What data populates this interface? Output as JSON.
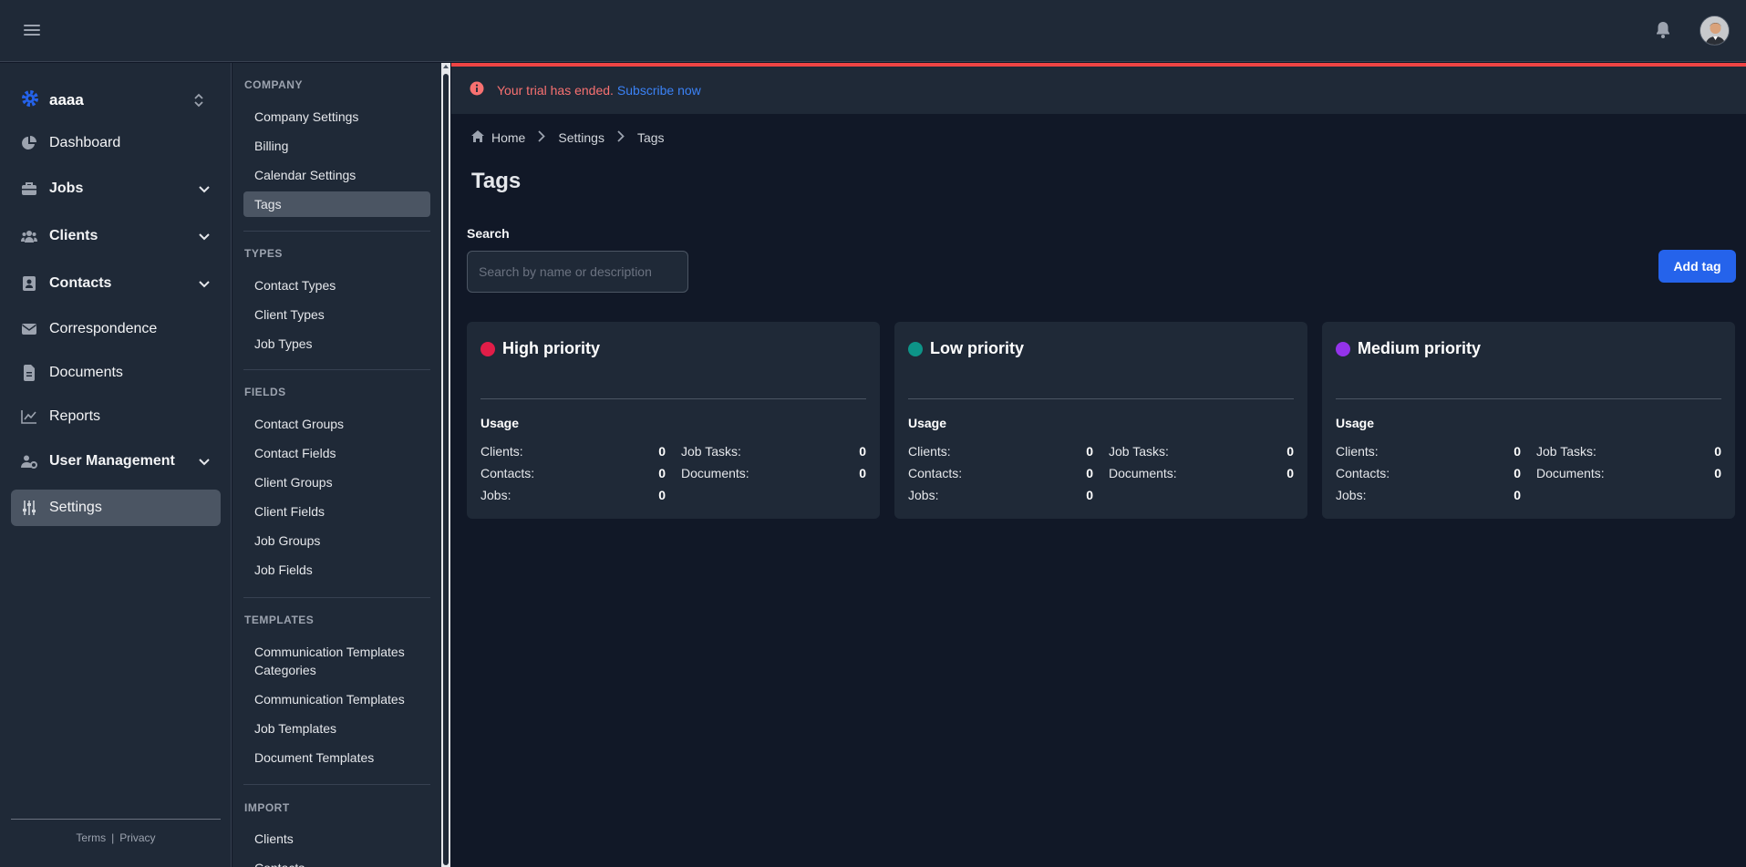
{
  "company": {
    "name": "aaaa"
  },
  "nav": {
    "dashboard": "Dashboard",
    "jobs": "Jobs",
    "clients": "Clients",
    "contacts": "Contacts",
    "correspondence": "Correspondence",
    "documents": "Documents",
    "reports": "Reports",
    "user_management": "User Management",
    "settings": "Settings"
  },
  "footer": {
    "terms": "Terms",
    "sep": "|",
    "privacy": "Privacy"
  },
  "subnav": {
    "company_header": "COMPANY",
    "company_settings": "Company Settings",
    "billing": "Billing",
    "calendar_settings": "Calendar Settings",
    "tags": "Tags",
    "types_header": "TYPES",
    "contact_types": "Contact Types",
    "client_types": "Client Types",
    "job_types": "Job Types",
    "fields_header": "FIELDS",
    "contact_groups": "Contact Groups",
    "contact_fields": "Contact Fields",
    "client_groups": "Client Groups",
    "client_fields": "Client Fields",
    "job_groups": "Job Groups",
    "job_fields": "Job Fields",
    "templates_header": "TEMPLATES",
    "comm_templates_categories": "Communication Templates Categories",
    "comm_templates": "Communication Templates",
    "job_templates": "Job Templates",
    "document_templates": "Document Templates",
    "import_header": "IMPORT",
    "import_clients": "Clients",
    "import_contacts": "Contacts"
  },
  "alert": {
    "text": "Your trial has ended.",
    "link": "Subscribe now"
  },
  "breadcrumb": {
    "home": "Home",
    "settings": "Settings",
    "tags": "Tags"
  },
  "page": {
    "title": "Tags",
    "search_label": "Search",
    "search_placeholder": "Search by name or description",
    "add_button": "Add tag"
  },
  "tags": [
    {
      "name": "High priority",
      "color": "#e11d48",
      "usage_label": "Usage",
      "clients_label": "Clients:",
      "clients": "0",
      "contacts_label": "Contacts:",
      "contacts": "0",
      "jobs_label": "Jobs:",
      "jobs": "0",
      "job_tasks_label": "Job Tasks:",
      "job_tasks": "0",
      "documents_label": "Documents:",
      "documents": "0"
    },
    {
      "name": "Low priority",
      "color": "#0d9488",
      "usage_label": "Usage",
      "clients_label": "Clients:",
      "clients": "0",
      "contacts_label": "Contacts:",
      "contacts": "0",
      "jobs_label": "Jobs:",
      "jobs": "0",
      "job_tasks_label": "Job Tasks:",
      "job_tasks": "0",
      "documents_label": "Documents:",
      "documents": "0"
    },
    {
      "name": "Medium priority",
      "color": "#9333ea",
      "usage_label": "Usage",
      "clients_label": "Clients:",
      "clients": "0",
      "contacts_label": "Contacts:",
      "contacts": "0",
      "jobs_label": "Jobs:",
      "jobs": "0",
      "job_tasks_label": "Job Tasks:",
      "job_tasks": "0",
      "documents_label": "Documents:",
      "documents": "0"
    }
  ],
  "colors": {
    "accent": "#2563eb",
    "alert_border": "#ef4444",
    "alert_text": "#f87171",
    "link": "#3b82f6",
    "company_icon": "#2563eb"
  }
}
